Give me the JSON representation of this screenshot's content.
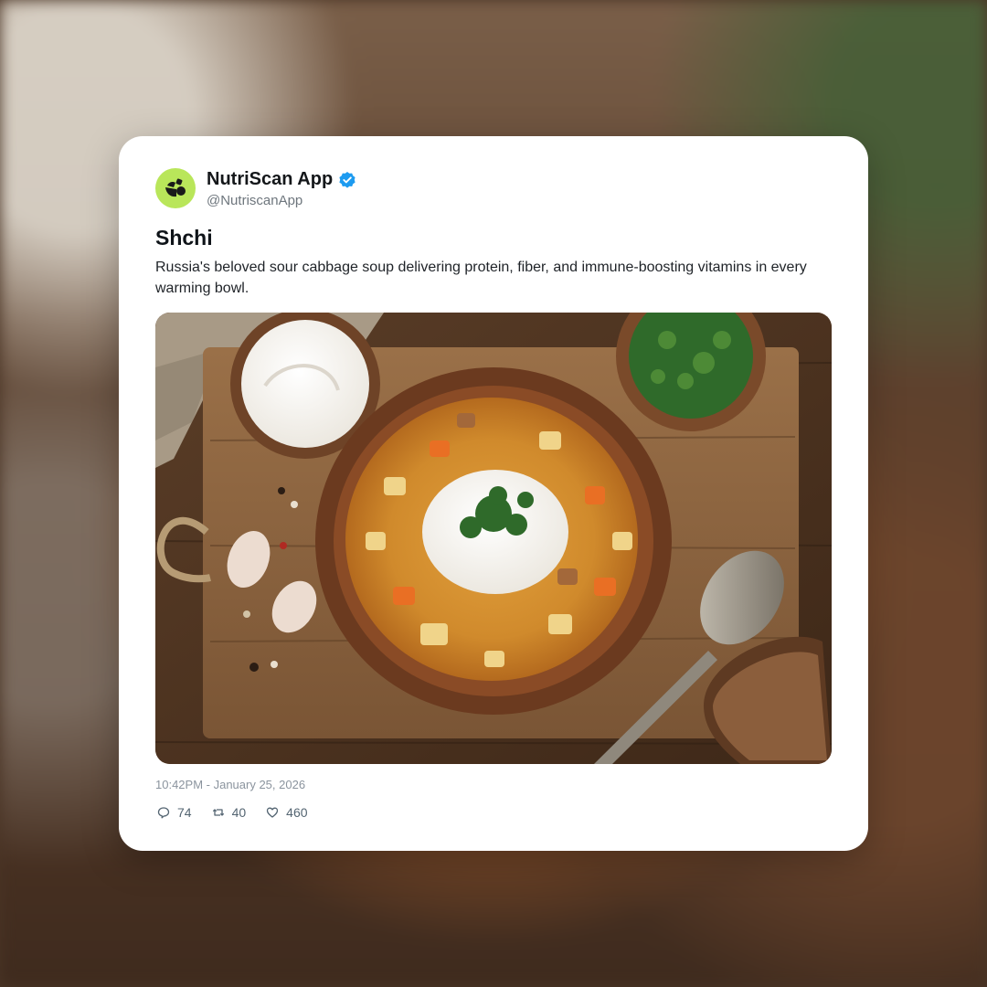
{
  "account": {
    "name": "NutriScan App",
    "handle": "@NutriscanApp",
    "verified": true,
    "avatar_color": "#b9e65a",
    "verified_color": "#1d9bf0"
  },
  "post": {
    "title": "Shchi",
    "description": "Russia's beloved sour cabbage soup delivering protein, fiber, and immune-boosting vitamins in every warming bowl.",
    "timestamp": "10:42PM - January 25, 2026"
  },
  "stats": {
    "replies": "74",
    "reposts": "40",
    "likes": "460"
  },
  "icons": [
    "nutriscan-logo-icon",
    "verified-badge-icon",
    "reply-icon",
    "repost-icon",
    "like-icon"
  ]
}
